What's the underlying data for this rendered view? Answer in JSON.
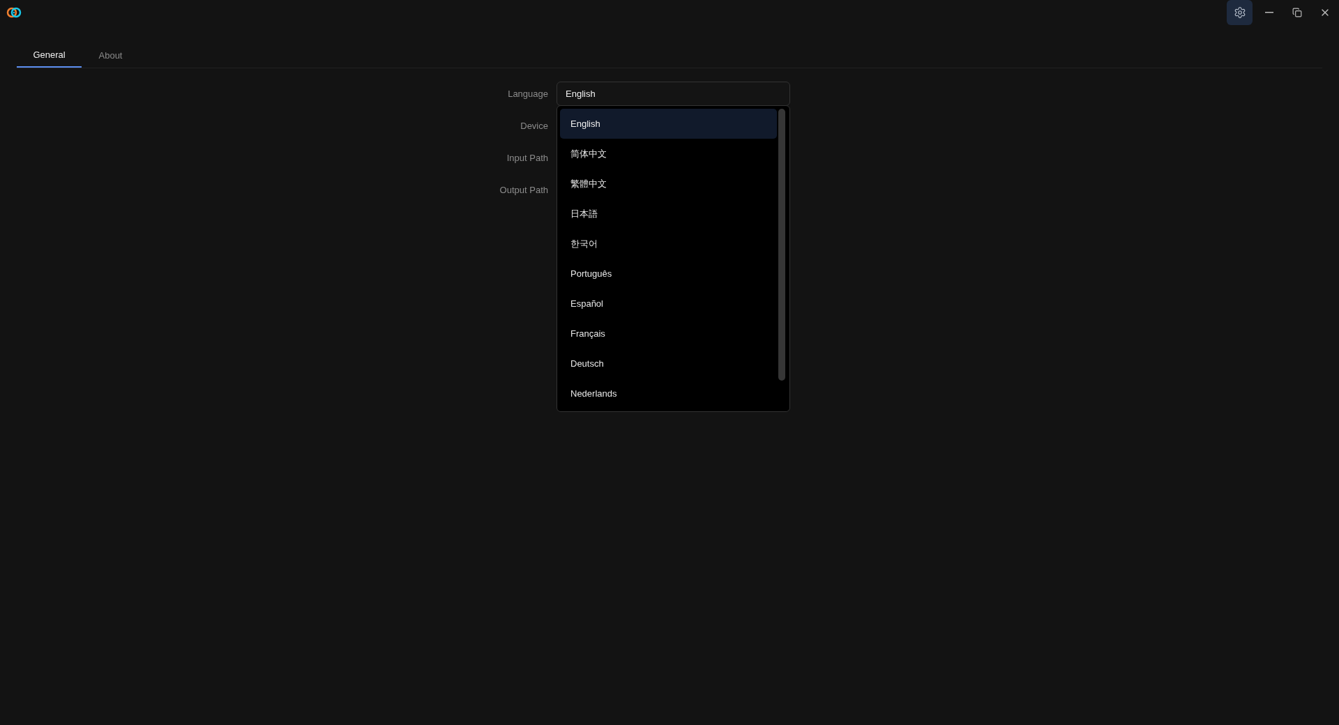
{
  "tabs": [
    {
      "label": "General",
      "selected": true
    },
    {
      "label": "About",
      "selected": false
    }
  ],
  "form": {
    "fields": [
      {
        "label": "Language",
        "value": "English"
      },
      {
        "label": "Device"
      },
      {
        "label": "Input Path"
      },
      {
        "label": "Output Path"
      }
    ]
  },
  "dropdown": {
    "expanded": true,
    "options": [
      {
        "label": "English",
        "selected": true
      },
      {
        "label": "简体中文",
        "selected": false
      },
      {
        "label": "繁體中文",
        "selected": false
      },
      {
        "label": "日本語",
        "selected": false
      },
      {
        "label": "한국어",
        "selected": false
      },
      {
        "label": "Português",
        "selected": false
      },
      {
        "label": "Español",
        "selected": false
      },
      {
        "label": "Français",
        "selected": false
      },
      {
        "label": "Deutsch",
        "selected": false
      },
      {
        "label": "Nederlands",
        "selected": false
      }
    ]
  }
}
